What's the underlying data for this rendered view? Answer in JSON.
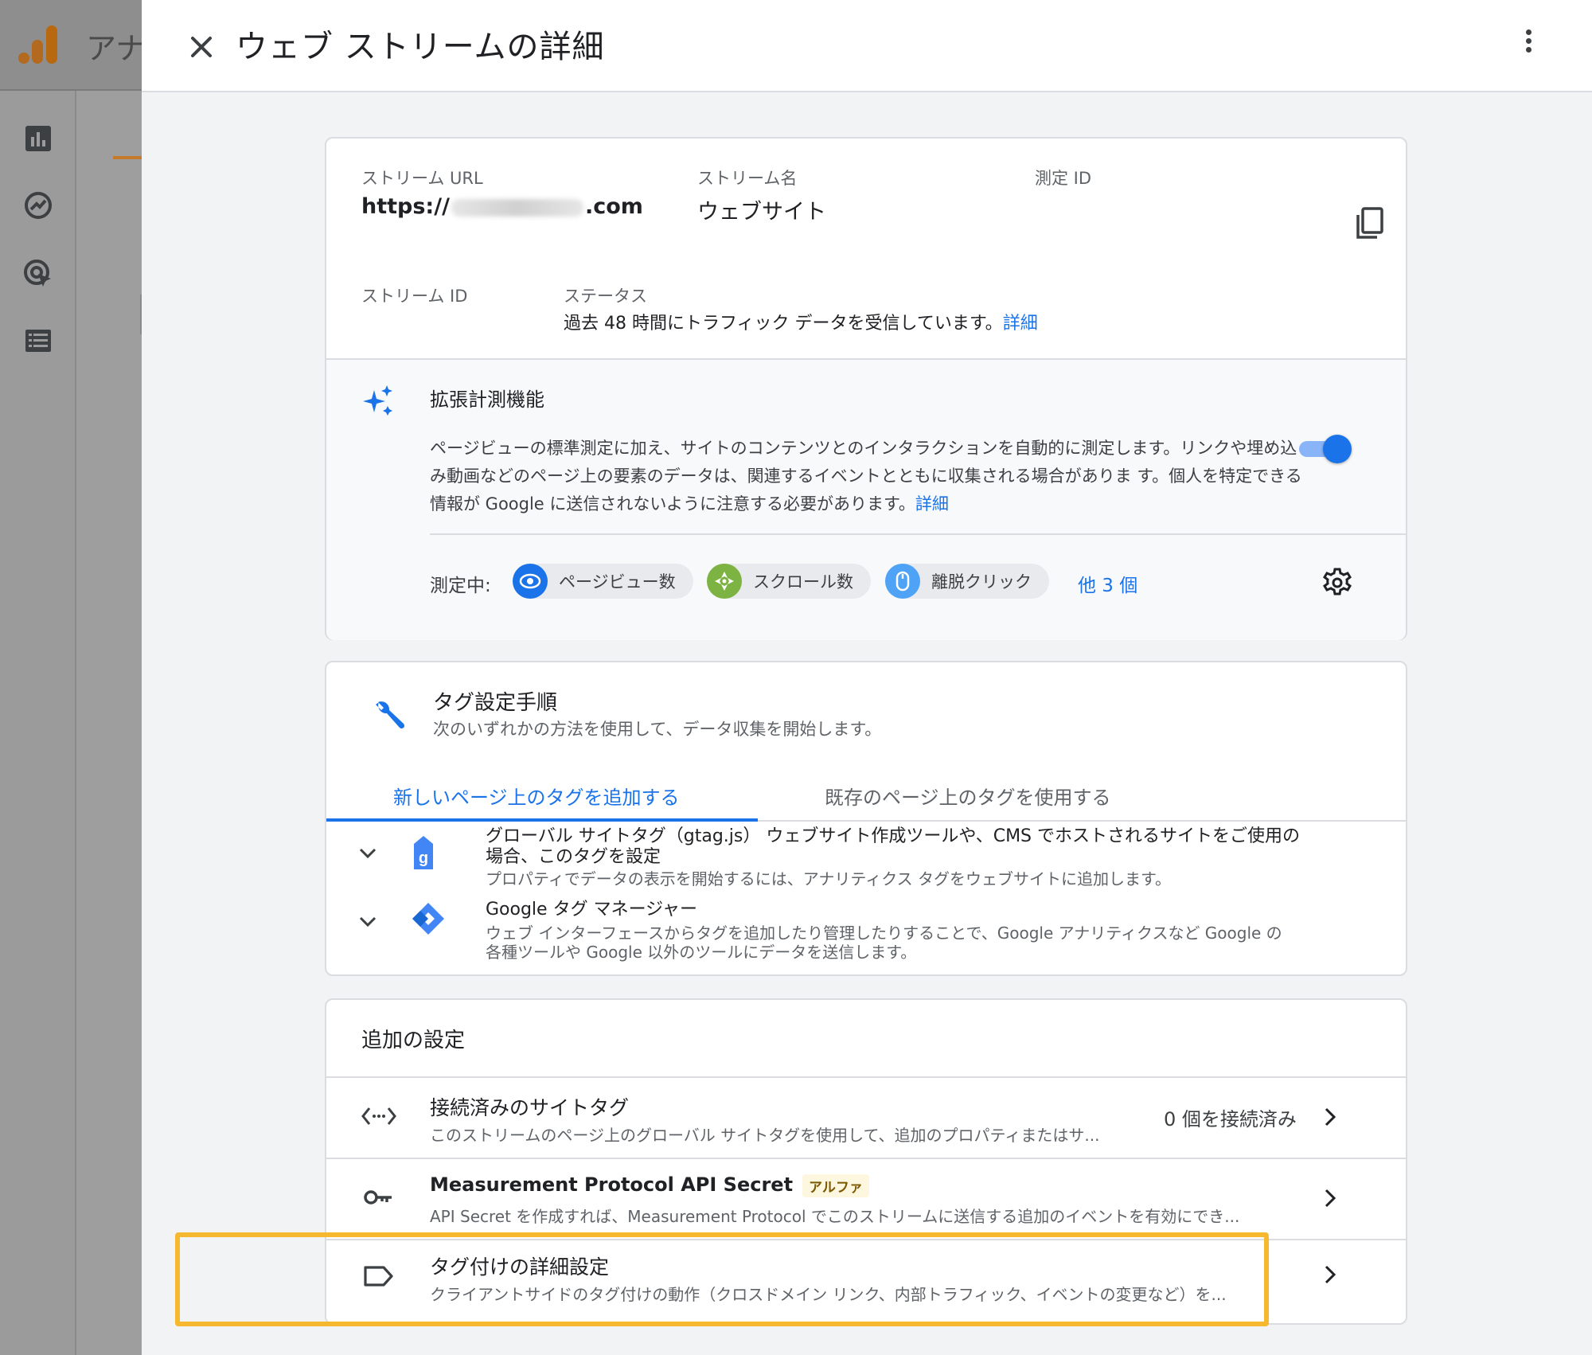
{
  "background": {
    "app_title": "アナ"
  },
  "panel": {
    "title": "ウェブ ストリームの詳細"
  },
  "stream": {
    "url_label": "ストリーム URL",
    "url_prefix": "https://",
    "url_suffix": ".com",
    "name_label": "ストリーム名",
    "name_value": "ウェブサイト",
    "measurement_id_label": "測定 ID",
    "stream_id_label": "ストリーム ID",
    "status_label": "ステータス",
    "status_text": "過去 48 時間にトラフィック データを受信しています。",
    "status_link": "詳細"
  },
  "enhanced": {
    "title": "拡張計測機能",
    "description": "ページビューの標準測定に加え、サイトのコンテンツとのインタラクションを自動的に測定します。リンクや埋め込み動画などのページ上の要素のデータは、関連するイベントとともに収集される場合がありま す。個人を特定できる情報が Google に送信されないように注意する必要があります。",
    "description_link": "詳細",
    "toggle_on": true,
    "measuring_label": "測定中:",
    "chips": [
      {
        "label": "ページビュー数",
        "icon": "eye-icon",
        "color": "#1a73e8"
      },
      {
        "label": "スクロール数",
        "icon": "compass-icon",
        "color": "#7cb342"
      },
      {
        "label": "離脱クリック",
        "icon": "mouse-icon",
        "color": "#4fa3f7"
      }
    ],
    "more_link": "他 3 個"
  },
  "tag_setup": {
    "title": "タグ設定手順",
    "subtitle": "次のいずれかの方法を使用して、データ収集を開始します。",
    "tabs": [
      {
        "label": "新しいページ上のタグを追加する",
        "active": true
      },
      {
        "label": "既存のページ上のタグを使用する",
        "active": false
      }
    ],
    "rows": [
      {
        "title_line1": "グローバル サイトタグ（gtag.js） ウェブサイト作成ツールや、CMS でホストされるサイトをご使用の",
        "title_line2": "場合、このタグを設定",
        "sub_line1": "プロパティでデータの表示を開始するには、アナリティクス タグをウェブサイトに追加します。",
        "sub_line2": ""
      },
      {
        "title_line1": "Google タグ マネージャー",
        "title_line2": "",
        "sub_line1": "ウェブ インターフェースからタグを追加したり管理したりすることで、Google アナリティクスなど Google の",
        "sub_line2": "各種ツールや Google 以外のツールにデータを送信します。"
      }
    ]
  },
  "additional": {
    "title": "追加の設定",
    "rows": [
      {
        "title": "接続済みのサイトタグ",
        "subtitle": "このストリームのページ上のグローバル サイトタグを使用して、追加のプロパティまたはサ...",
        "meta": "0 個を接続済み"
      },
      {
        "title": "Measurement Protocol API Secret",
        "badge": "アルファ",
        "subtitle": "API Secret を作成すれば、Measurement Protocol でこのストリームに送信する追加のイベントを有効にでき..."
      },
      {
        "title": "タグ付けの詳細設定",
        "subtitle": "クライアントサイドのタグ付けの動作（クロスドメイン リンク、内部トラフィック、イベントの変更など）を..."
      }
    ]
  },
  "colors": {
    "accent": "#1a73e8",
    "highlight": "#f5b82e",
    "panel_bg": "#f1f3f4"
  }
}
